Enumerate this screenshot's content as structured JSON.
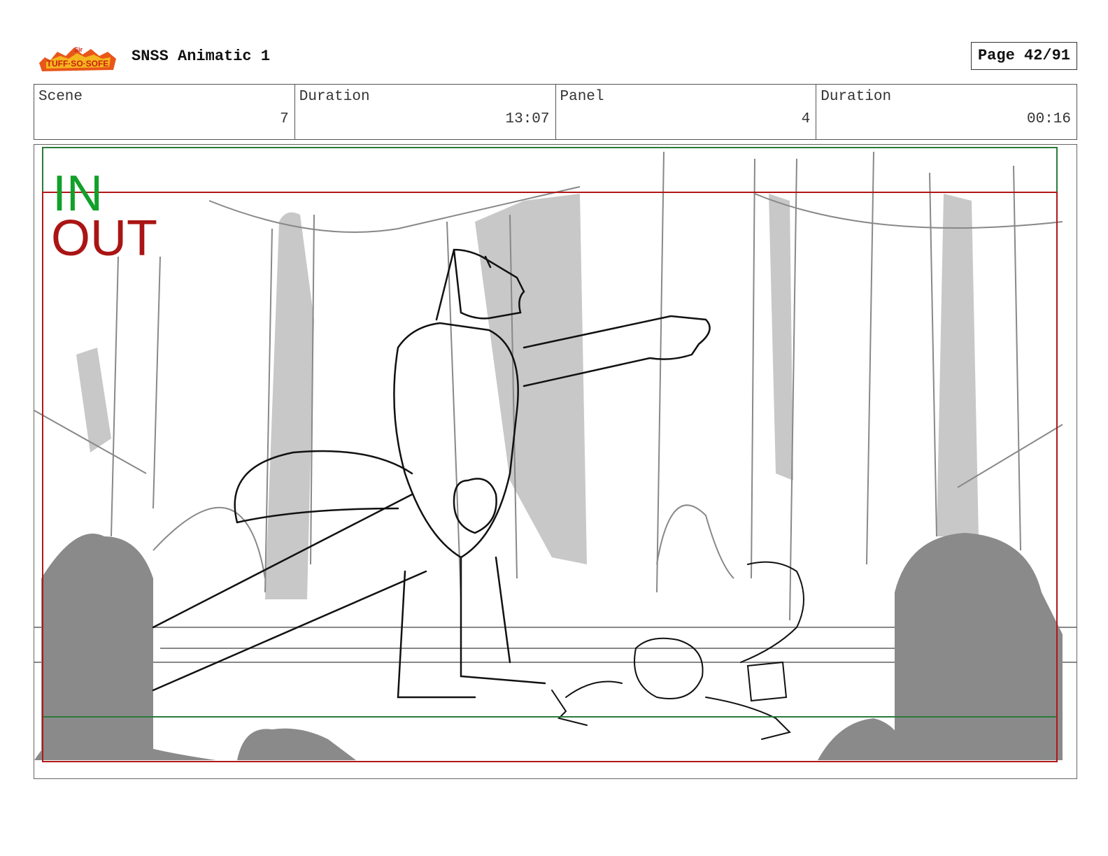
{
  "header": {
    "title": "SNSS Animatic 1",
    "page_label": "Page 42/91",
    "logo_text": "Sir Tuff-So-Sofe"
  },
  "info": {
    "scene_label": "Scene",
    "scene_value": "7",
    "duration_label": "Duration",
    "duration_value": "13:07",
    "panel_label": "Panel",
    "panel_value": "4",
    "panel_duration_label": "Duration",
    "panel_duration_value": "00:16"
  },
  "frame": {
    "in_label": "IN",
    "out_label": "OUT",
    "in_color": "#12a02a",
    "out_color": "#aa1414"
  }
}
